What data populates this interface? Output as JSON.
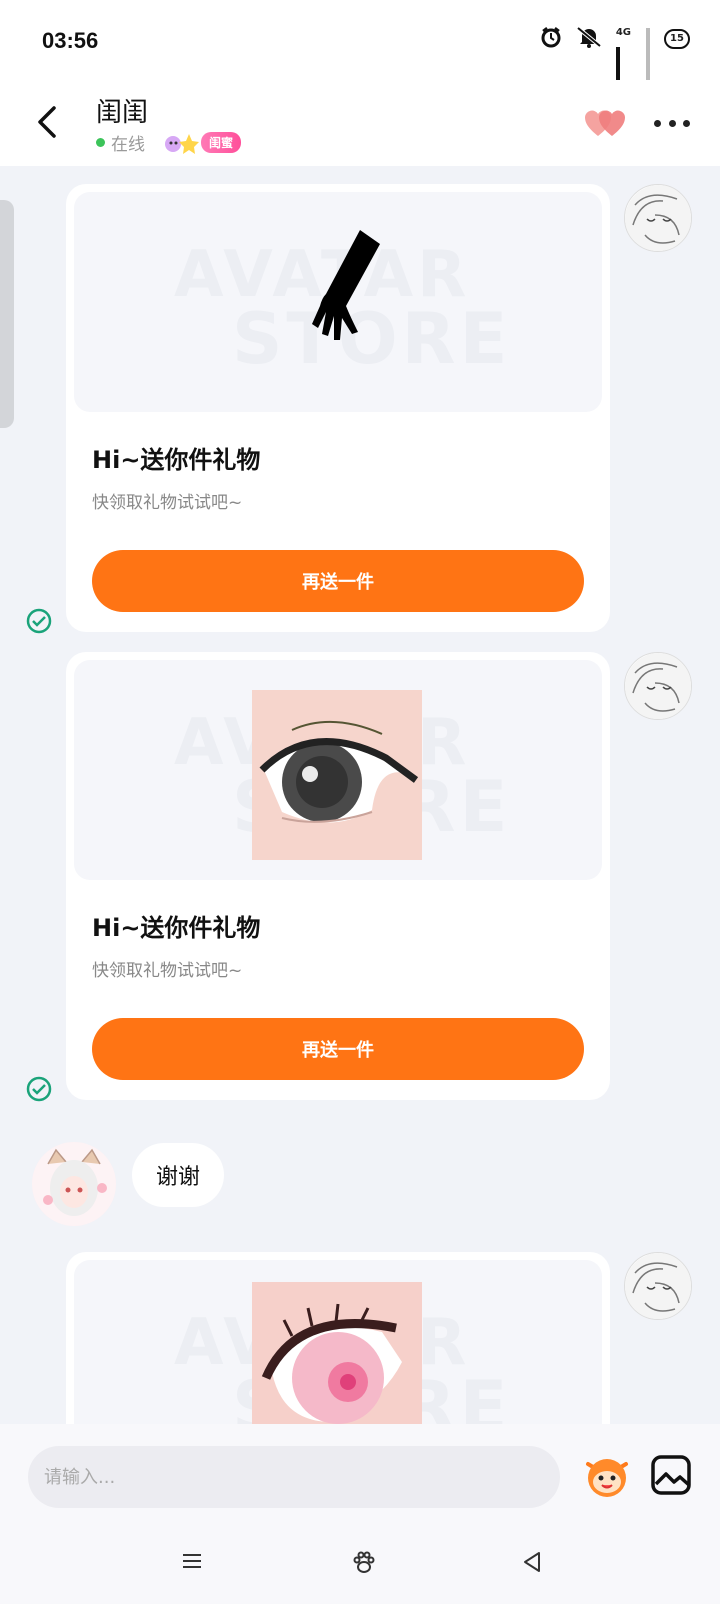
{
  "status_bar": {
    "time": "03:56",
    "network_label": "4G",
    "battery_level": "15"
  },
  "header": {
    "title": "闺闺",
    "online_text": "在线",
    "badge": "闺蜜"
  },
  "messages": {
    "gift_cards": [
      {
        "title": "Hi~送你件礼物",
        "subtitle": "快领取礼物试试吧~",
        "button": "再送一件",
        "watermark_line1": "AVATAR",
        "watermark_line2": "STORE",
        "item": "glove-icon"
      },
      {
        "title": "Hi~送你件礼物",
        "subtitle": "快领取礼物试试吧~",
        "button": "再送一件",
        "watermark_line1": "AVATAR",
        "watermark_line2": "STORE",
        "item": "eye-icon"
      },
      {
        "watermark_line1": "AVATAR",
        "watermark_line2": "STORE",
        "item": "pink-eye-icon"
      }
    ],
    "incoming_text": "谢谢"
  },
  "input": {
    "placeholder": "请输入..."
  },
  "colors": {
    "accent": "#ff7414",
    "online": "#3cc45a",
    "badge": "#ff4f9a",
    "check": "#1aa37a"
  }
}
